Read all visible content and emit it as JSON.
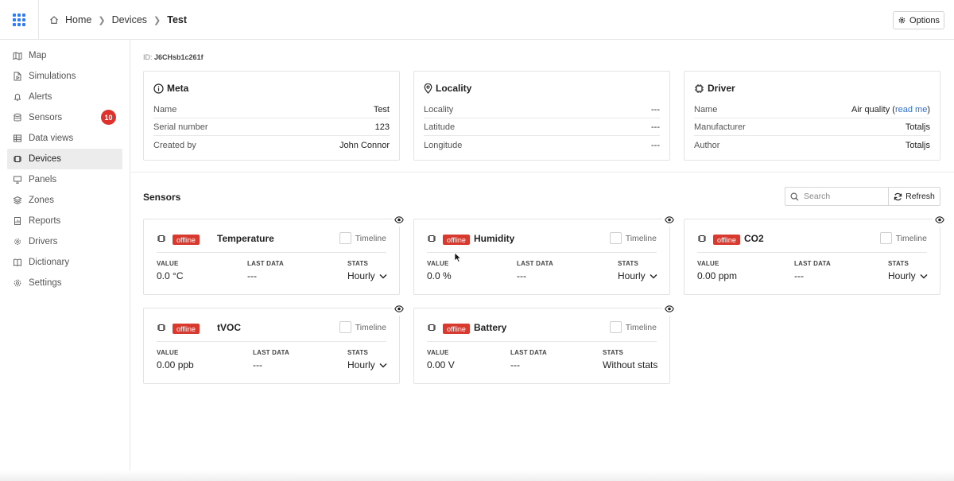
{
  "header": {
    "breadcrumbs": [
      "Home",
      "Devices",
      "Test"
    ],
    "options_label": "Options"
  },
  "sidebar": {
    "items": [
      {
        "label": "Map",
        "icon": "map-icon"
      },
      {
        "label": "Simulations",
        "icon": "file-play-icon"
      },
      {
        "label": "Alerts",
        "icon": "bell-icon"
      },
      {
        "label": "Sensors",
        "icon": "database-icon",
        "badge": "10"
      },
      {
        "label": "Data views",
        "icon": "table-icon"
      },
      {
        "label": "Devices",
        "icon": "chip-icon",
        "active": true
      },
      {
        "label": "Panels",
        "icon": "monitor-icon"
      },
      {
        "label": "Zones",
        "icon": "layers-icon"
      },
      {
        "label": "Reports",
        "icon": "report-icon"
      },
      {
        "label": "Drivers",
        "icon": "cog-chip-icon"
      },
      {
        "label": "Dictionary",
        "icon": "book-icon"
      },
      {
        "label": "Settings",
        "icon": "gear-icon"
      }
    ]
  },
  "device": {
    "id_label": "ID:",
    "id": "J6CHsb1c261f"
  },
  "meta": {
    "title": "Meta",
    "rows": [
      {
        "label": "Name",
        "value": "Test"
      },
      {
        "label": "Serial number",
        "value": "123"
      },
      {
        "label": "Created by",
        "value": "John Connor"
      }
    ]
  },
  "locality": {
    "title": "Locality",
    "rows": [
      {
        "label": "Locality",
        "value": "---"
      },
      {
        "label": "Latitude",
        "value": "---"
      },
      {
        "label": "Longitude",
        "value": "---"
      }
    ]
  },
  "driver": {
    "title": "Driver",
    "rows": [
      {
        "label": "Name",
        "value": "Air quality",
        "link_open": "(",
        "link": "read me",
        "link_close": ")"
      },
      {
        "label": "Manufacturer",
        "value": "Totaljs"
      },
      {
        "label": "Author",
        "value": "Totaljs"
      }
    ]
  },
  "sensors": {
    "title": "Sensors",
    "search_placeholder": "Search",
    "refresh_label": "Refresh",
    "timeline_label": "Timeline",
    "col_value": "VALUE",
    "col_last": "LAST DATA",
    "col_stats": "STATS",
    "items": [
      {
        "status": "offline",
        "name": "Temperature",
        "value": "0.0 °C",
        "last_data": "---",
        "stats": "Hourly",
        "has_dropdown": true
      },
      {
        "status": "offline",
        "name": "Humidity",
        "value": "0.0 %",
        "last_data": "---",
        "stats": "Hourly",
        "has_dropdown": true
      },
      {
        "status": "offline",
        "name": "CO2",
        "value": "0.00 ppm",
        "last_data": "---",
        "stats": "Hourly",
        "has_dropdown": true
      },
      {
        "status": "offline",
        "name": "tVOC",
        "value": "0.00 ppb",
        "last_data": "---",
        "stats": "Hourly",
        "has_dropdown": true
      },
      {
        "status": "offline",
        "name": "Battery",
        "value": "0.00 V",
        "last_data": "---",
        "stats": "Without stats",
        "has_dropdown": false
      }
    ]
  },
  "colors": {
    "accent": "#2f7df6",
    "badge_red": "#e0322c",
    "offline_red": "#d93a2f",
    "link": "#2f6fd8"
  }
}
